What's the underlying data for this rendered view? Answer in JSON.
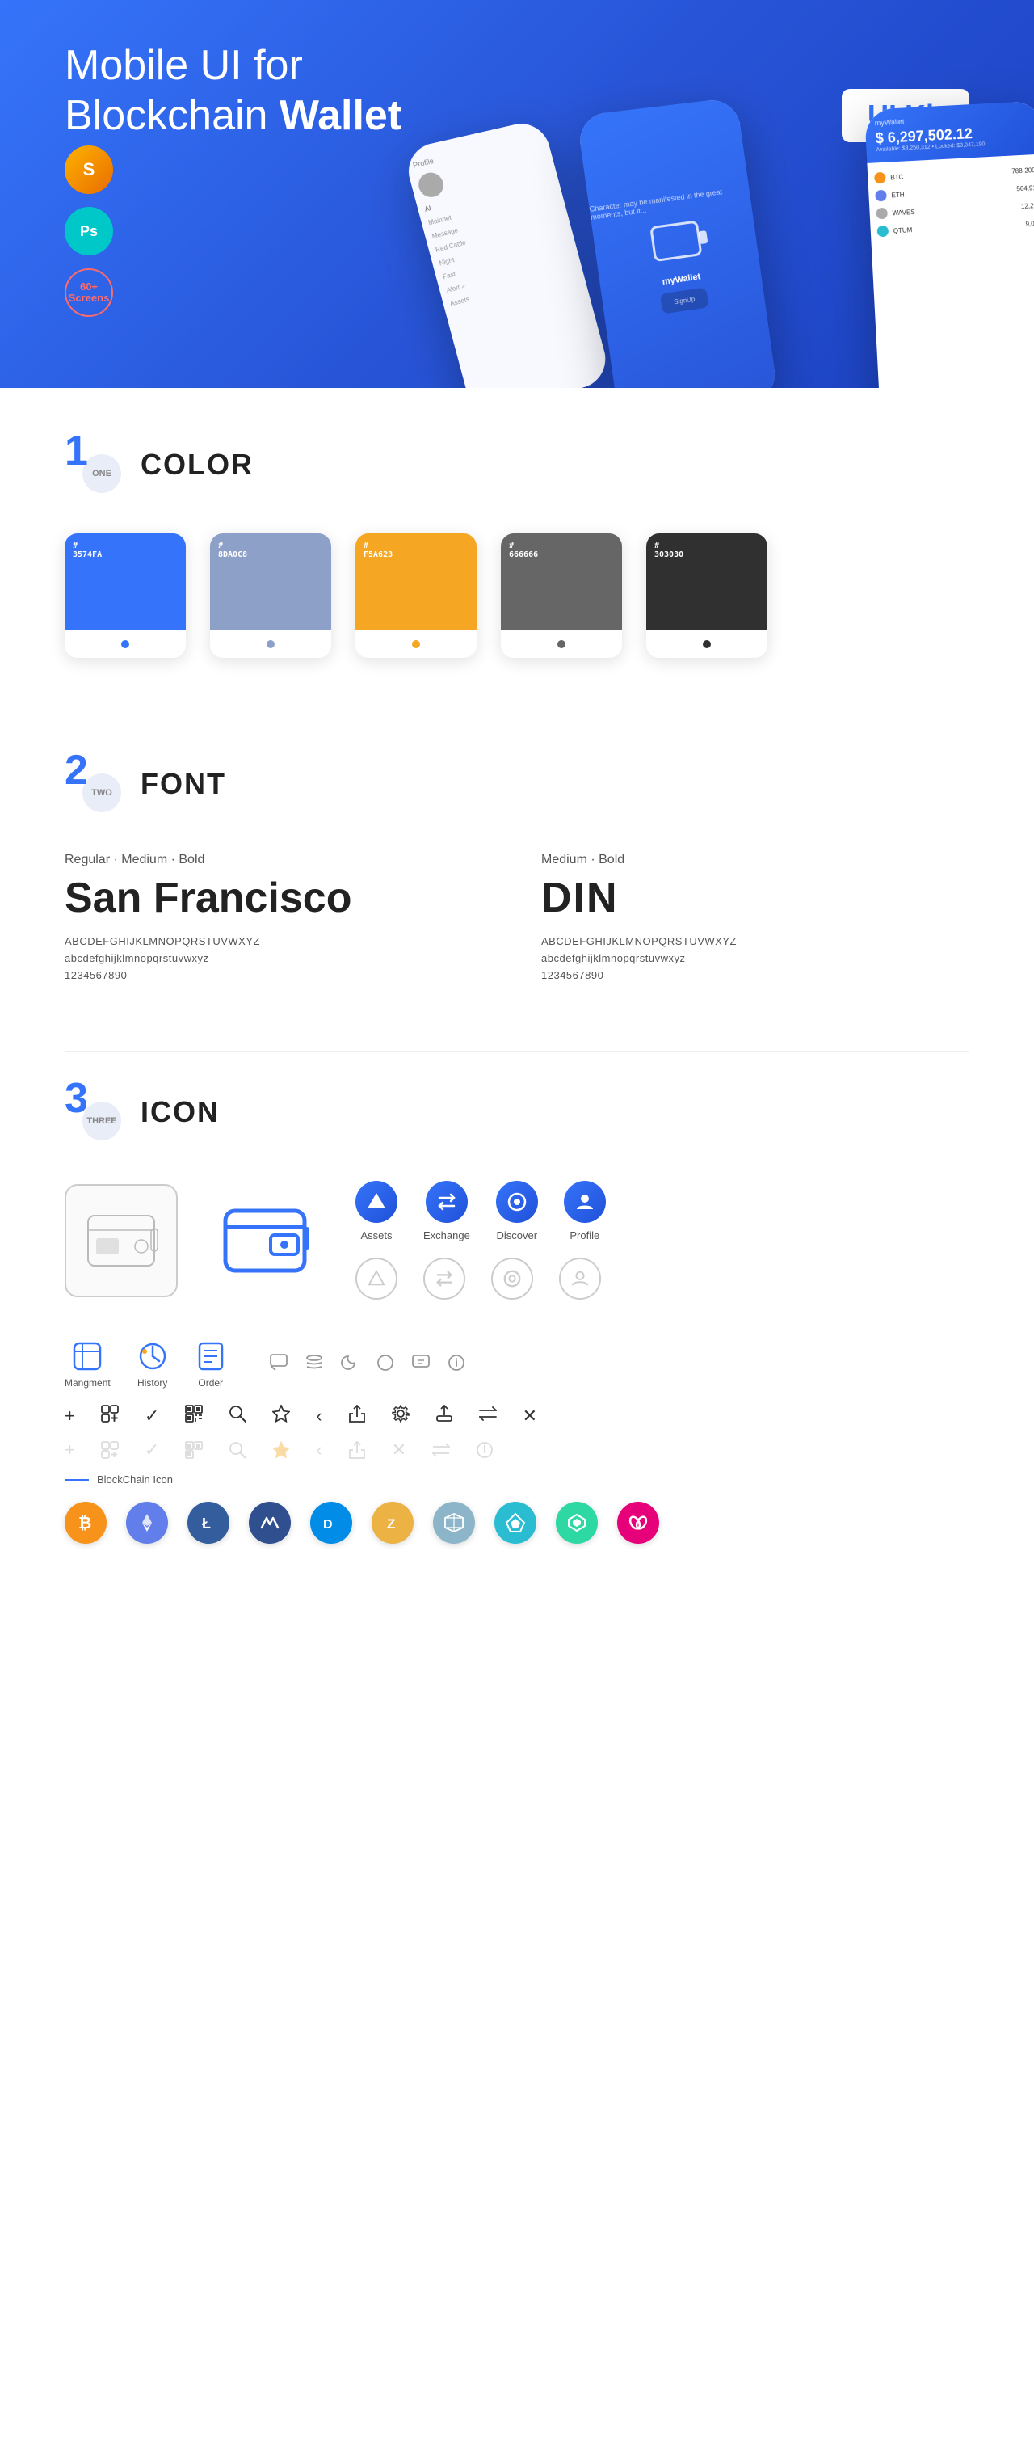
{
  "hero": {
    "title_light": "Mobile UI for Blockchain ",
    "title_bold": "Wallet",
    "badge": "UI Kit",
    "sketch_label": "S",
    "ps_label": "Ps",
    "screens_count": "60+",
    "screens_label": "Screens"
  },
  "sections": {
    "color": {
      "number": "1",
      "word": "ONE",
      "title": "COLOR",
      "swatches": [
        {
          "hex": "#3574FA",
          "code": "#\n3574FA",
          "dot_color": "#2855d8"
        },
        {
          "hex": "#8DA0C8",
          "code": "#\n8DA0C8",
          "dot_color": "#7a90b5"
        },
        {
          "hex": "#F5A623",
          "code": "#\nF5A623",
          "dot_color": "#e09010"
        },
        {
          "hex": "#666666",
          "code": "#\n666666",
          "dot_color": "#555"
        },
        {
          "hex": "#303030",
          "code": "#\n303030",
          "dot_color": "#222"
        }
      ]
    },
    "font": {
      "number": "2",
      "word": "TWO",
      "title": "FONT",
      "fonts": [
        {
          "weights": "Regular · Medium · Bold",
          "name": "San Francisco",
          "uppercase": "ABCDEFGHIJKLMNOPQRSTUVWXYZ",
          "lowercase": "abcdefghijklmnopqrstuvwxyz",
          "numbers": "1234567890"
        },
        {
          "weights": "Medium · Bold",
          "name": "DIN",
          "uppercase": "ABCDEFGHIJKLMNOPQRSTUVWXYZ",
          "lowercase": "abcdefghijklmnopqrstuvwxyz",
          "numbers": "1234567890"
        }
      ]
    },
    "icon": {
      "number": "3",
      "word": "THREE",
      "title": "ICON",
      "nav_icons": [
        {
          "label": "Assets",
          "color": "#3574FA",
          "symbol": "◆"
        },
        {
          "label": "Exchange",
          "color": "#3574FA",
          "symbol": "⇄"
        },
        {
          "label": "Discover",
          "color": "#3574FA",
          "symbol": "●"
        },
        {
          "label": "Profile",
          "color": "#3574FA",
          "symbol": "⌂"
        }
      ],
      "tab_icons": [
        {
          "label": "Mangment",
          "symbol": "▣"
        },
        {
          "label": "History",
          "symbol": "◷"
        },
        {
          "label": "Order",
          "symbol": "≡"
        }
      ],
      "small_icons": [
        "+",
        "⊞",
        "✓",
        "⊡",
        "⌕",
        "☆",
        "‹",
        "⊲",
        "⚙",
        "⊡",
        "⇄",
        "✕"
      ],
      "blockchain_label": "BlockChain Icon",
      "crypto_coins": [
        {
          "symbol": "₿",
          "color": "#F7931A",
          "label": "Bitcoin"
        },
        {
          "symbol": "Ξ",
          "color": "#627EEA",
          "label": "Ethereum"
        },
        {
          "symbol": "Ł",
          "color": "#345D9D",
          "label": "Litecoin"
        },
        {
          "symbol": "◆",
          "color": "#3D9970",
          "label": "WAVES"
        },
        {
          "symbol": "D",
          "color": "#008CE7",
          "label": "Dash"
        },
        {
          "symbol": "Z",
          "color": "#ECB244",
          "label": "Zcash"
        },
        {
          "symbol": "✦",
          "color": "#A5A5A5",
          "label": "Grid"
        },
        {
          "symbol": "▲",
          "color": "#2ABDD2",
          "label": "Stratis"
        },
        {
          "symbol": "◈",
          "color": "#5A4FCF",
          "label": "Decred"
        },
        {
          "symbol": "∞",
          "color": "#E83E8C",
          "label": "Polkadot"
        }
      ]
    }
  }
}
